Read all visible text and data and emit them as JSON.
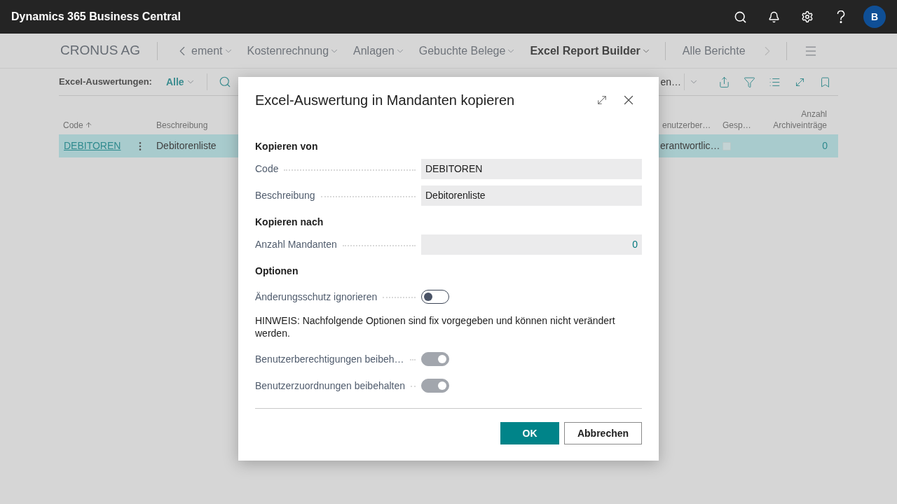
{
  "app_bar": {
    "title": "Dynamics 365 Business Central",
    "avatar": "B"
  },
  "nav": {
    "company": "CRONUS AG",
    "items": [
      {
        "label": "ement",
        "kind": "back",
        "selected": false
      },
      {
        "label": "Kostenrechnung",
        "kind": "menu",
        "selected": false
      },
      {
        "label": "Anlagen",
        "kind": "menu",
        "selected": false
      },
      {
        "label": "Gebuchte Belege",
        "kind": "menu",
        "selected": false
      },
      {
        "label": "Excel Report Builder",
        "kind": "menu",
        "selected": true
      },
      {
        "label": "Alle Berichte",
        "kind": "link",
        "selected": false
      }
    ]
  },
  "action_bar": {
    "filter_label": "Excel-Auswertungen:",
    "filter_value": "Alle",
    "partial_action": "en…"
  },
  "table": {
    "columns": [
      {
        "label": "Code",
        "sorted": true
      },
      {
        "label": "Beschreibung",
        "sorted": false
      },
      {
        "label": "enutzerber…",
        "sorted": false
      },
      {
        "label": "Gesp…",
        "sorted": false
      },
      {
        "label": "Anzahl Archiveinträge",
        "sorted": false
      }
    ],
    "rows": [
      {
        "code": "DEBITOREN",
        "description": "Debitorenliste",
        "column_3": "erantwortlic…",
        "checked": false,
        "count": "0",
        "selected": true
      }
    ]
  },
  "dialog": {
    "title": "Excel-Auswertung in Mandanten kopieren",
    "sections": [
      {
        "heading": "Kopieren von",
        "fields": [
          {
            "kind": "text",
            "label": "Code",
            "value": "DEBITOREN"
          },
          {
            "kind": "text",
            "label": "Beschreibung",
            "value": "Debitorenliste"
          }
        ]
      },
      {
        "heading": "Kopieren nach",
        "fields": [
          {
            "kind": "number",
            "label": "Anzahl Mandanten",
            "value": "0"
          }
        ]
      },
      {
        "heading": "Optionen",
        "fields": [
          {
            "kind": "toggle",
            "label": "Änderungsschutz ignorieren",
            "on": false,
            "disabled": false
          },
          {
            "kind": "note",
            "text": "HINWEIS: Nachfolgende Optionen sind fix vorgegeben und können nicht verändert werden."
          },
          {
            "kind": "toggle",
            "label": "Benutzerberechtigungen beibeh…",
            "on": true,
            "disabled": true
          },
          {
            "kind": "toggle",
            "label": "Benutzerzuordnungen beibehalten",
            "on": true,
            "disabled": true
          }
        ]
      }
    ],
    "buttons": [
      {
        "label": "OK",
        "kind": "primary"
      },
      {
        "label": "Abbrechen",
        "kind": "secondary"
      }
    ]
  }
}
